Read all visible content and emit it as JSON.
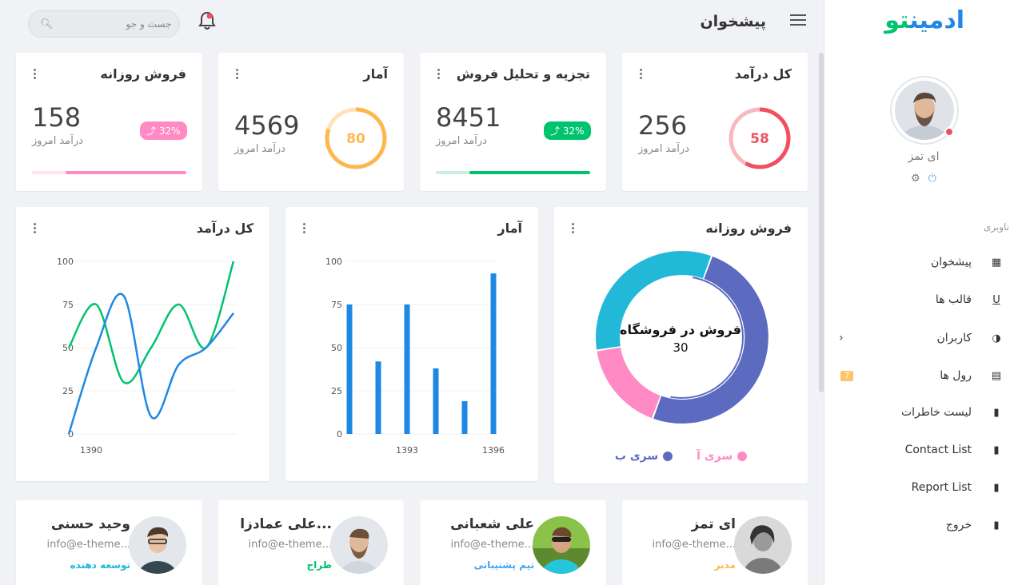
{
  "brand": {
    "part1": "ادمین",
    "part2": "تو"
  },
  "header": {
    "title": "پیشخوان",
    "search_placeholder": "جست و جو"
  },
  "user": {
    "name": "ای تمز"
  },
  "nav": {
    "title": "ناوبری",
    "items": [
      {
        "label": "پیشخوان",
        "icon": "dashboard-icon"
      },
      {
        "label": "قالب ها",
        "icon": "underline-icon"
      },
      {
        "label": "کاربران",
        "icon": "contrast-icon",
        "has_submenu": true
      },
      {
        "label": "رول ها",
        "icon": "list-icon",
        "badge": "7"
      },
      {
        "label": "لیست خاطرات",
        "icon": "book-icon"
      },
      {
        "label": "Contact List",
        "icon": "book-icon"
      },
      {
        "label": "Report List",
        "icon": "book-icon"
      },
      {
        "label": "خروج",
        "icon": "book-icon"
      }
    ]
  },
  "stats": [
    {
      "title": "کل درآمد",
      "value": "256",
      "sub": "درآمد امروز",
      "ring_value": "58",
      "ring_percent": 58,
      "color": "#f0505f",
      "light": "#f9b8be"
    },
    {
      "title": "تجزیه و تحلیل فروش",
      "value": "8451",
      "sub": "درآمد امروز",
      "pill": "32%",
      "color": "#00c36e",
      "light": "#c8f0dc",
      "bar_percent": 78
    },
    {
      "title": "آمار",
      "value": "4569",
      "sub": "درآمد امروز",
      "ring_value": "80",
      "ring_percent": 80,
      "color": "#ffb74d",
      "light": "#ffe2b8"
    },
    {
      "title": "فروش روزانه",
      "value": "158",
      "sub": "درآمد امروز",
      "pill": "32%",
      "color": "#ff8ac4",
      "light": "#ffe1ef",
      "bar_percent": 78
    }
  ],
  "charts": {
    "donut": {
      "title": "فروش روزانه",
      "center_title": "فروش در فروشگاه",
      "center_value": "30",
      "legend": [
        {
          "label": "سری آ",
          "color": "#ff8ac4"
        },
        {
          "label": "سری ب",
          "color": "#5c6bc0"
        }
      ]
    },
    "bar": {
      "title": "آمار"
    },
    "line": {
      "title": "کل درآمد"
    }
  },
  "chart_data": [
    {
      "type": "pie",
      "title": "فروش روزانه",
      "slices": [
        {
          "name": "سری ب",
          "value": 50,
          "color": "#5c6bc0"
        },
        {
          "name": "سری آ",
          "value": 17,
          "color": "#ff8ac4"
        },
        {
          "name": "",
          "value": 33,
          "color": "#22b8d8"
        }
      ]
    },
    {
      "type": "bar",
      "title": "آمار",
      "ylim": [
        0,
        100
      ],
      "yticks": [
        0,
        25,
        50,
        75,
        100
      ],
      "x": [
        1391,
        1392,
        1393,
        1394,
        1395,
        1396
      ],
      "xtick_labels": [
        1393,
        1396
      ],
      "values": [
        75,
        42,
        75,
        38,
        19,
        93
      ],
      "color": "#1e88e5"
    },
    {
      "type": "line",
      "title": "کل درآمد",
      "ylim": [
        0,
        100
      ],
      "yticks": [
        0,
        25,
        50,
        75,
        100
      ],
      "x": [
        1390,
        1391,
        1392,
        1393,
        1394,
        1395,
        1396
      ],
      "xtick_labels": [
        1390
      ],
      "series": [
        {
          "values": [
            50,
            75,
            30,
            50,
            75,
            50,
            100
          ],
          "color": "#00c36e"
        },
        {
          "values": [
            0,
            50,
            80,
            10,
            40,
            50,
            70
          ],
          "color": "#1e88e5"
        }
      ]
    }
  ],
  "people": [
    {
      "name": "ای تمز",
      "email": "info@e-theme...",
      "role": "مدیر",
      "role_color": "#ffb74d"
    },
    {
      "name": "علی شعبانی",
      "email": "info@e-theme...",
      "role": "تیم پشتیبانی",
      "role_color": "#42a5f5"
    },
    {
      "name": "علی عمادزا...",
      "email": "info@e-theme...",
      "role": "طراح",
      "role_color": "#00c36e"
    },
    {
      "name": "وحید حسنی",
      "email": "info@e-theme...",
      "role": "توسعه دهنده",
      "role_color": "#22b8d8"
    }
  ]
}
